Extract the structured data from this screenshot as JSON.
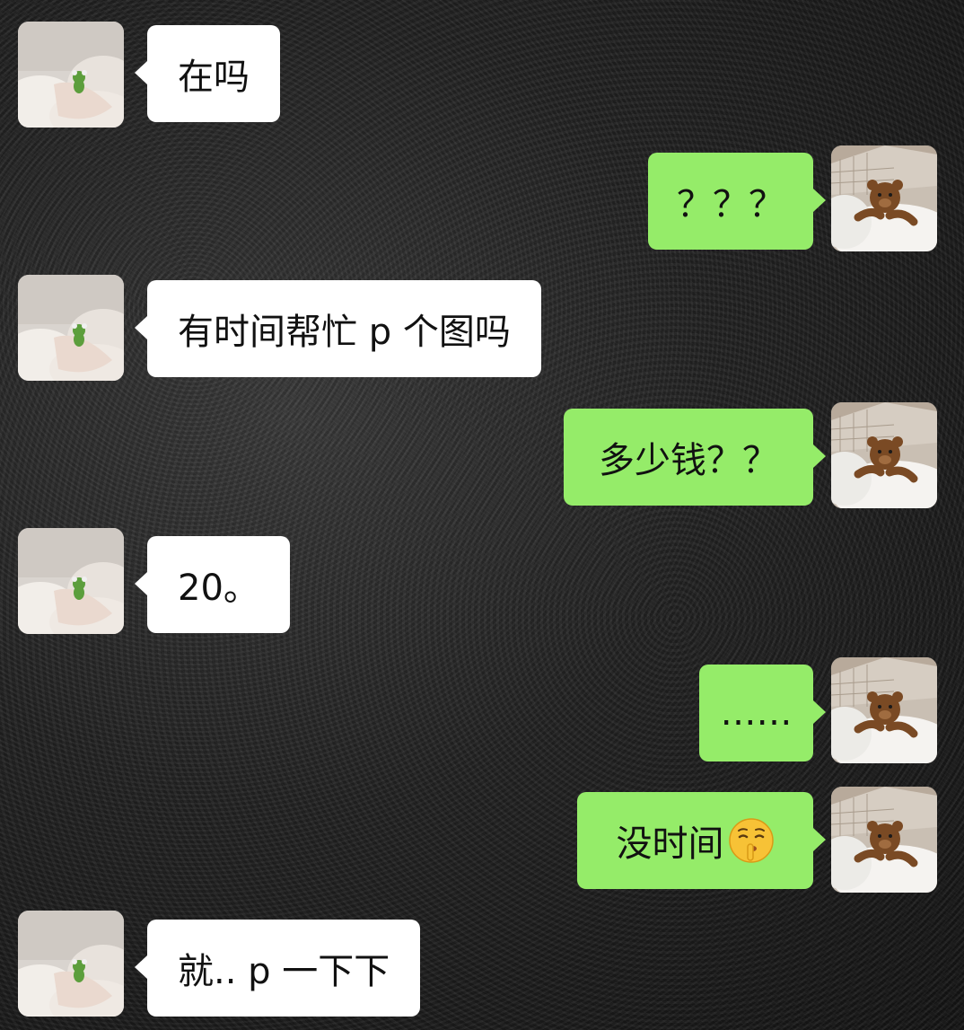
{
  "chat": {
    "messages": [
      {
        "sender": "them",
        "text": "在吗"
      },
      {
        "sender": "me",
        "text": "？？？"
      },
      {
        "sender": "them",
        "text": "有时间帮忙 p 个图吗"
      },
      {
        "sender": "me",
        "text": "多少钱？？"
      },
      {
        "sender": "them",
        "text": "20。"
      },
      {
        "sender": "me",
        "text": "……"
      },
      {
        "sender": "me",
        "text": "没时间",
        "emoji": "shushing-face-emoji"
      },
      {
        "sender": "them",
        "text": "就.. p 一下下"
      }
    ]
  },
  "avatars": {
    "them": "avatar-frog-in-bed",
    "me": "avatar-teddy-bear-in-bed"
  },
  "colors": {
    "incoming_bubble": "#ffffff",
    "outgoing_bubble": "#95ec69",
    "background": "#1c1c1c"
  }
}
